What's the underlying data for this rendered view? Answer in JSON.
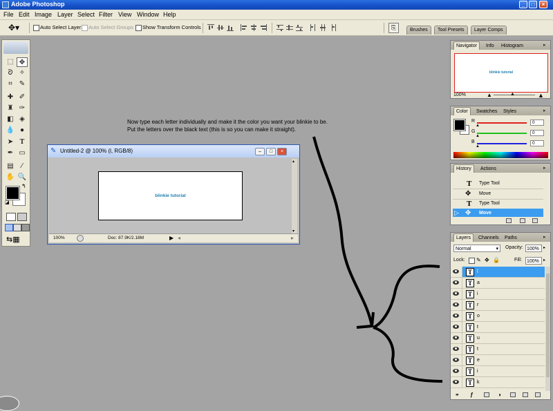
{
  "app": {
    "title": "Adobe Photoshop"
  },
  "menu": [
    "File",
    "Edit",
    "Image",
    "Layer",
    "Select",
    "Filter",
    "View",
    "Window",
    "Help"
  ],
  "options": {
    "auto_select_layer": "Auto Select Layer",
    "auto_select_groups": "Auto Select Groups",
    "show_transform_controls": "Show Transform Controls",
    "well_tabs": [
      "Brushes",
      "Tool Presets",
      "Layer Comps"
    ]
  },
  "instructions": [
    "Now type each letter individually and make it the color you want your blinkie to be.",
    "Put the letters over the black text (this is so you can make it straight)."
  ],
  "document": {
    "title": "Untitled-2 @ 100% (l, RGB/8)",
    "canvas_text": "blinkie tutorial",
    "zoom": "100%",
    "doc_info": "Doc: 87.9K/2.18M"
  },
  "navigator": {
    "tabs": [
      "Navigator",
      "Info",
      "Histogram"
    ],
    "preview_text": "blinkie tutorial",
    "zoom": "100%"
  },
  "color": {
    "tabs": [
      "Color",
      "Swatches",
      "Styles"
    ],
    "channels": [
      {
        "label": "R",
        "value": "0",
        "color": "#e02020"
      },
      {
        "label": "G",
        "value": "0",
        "color": "#20c020"
      },
      {
        "label": "B",
        "value": "0",
        "color": "#2020e0"
      }
    ]
  },
  "history": {
    "tabs": [
      "History",
      "Actions"
    ],
    "items": [
      "Type Tool",
      "Move",
      "Type Tool",
      "Move"
    ]
  },
  "layers": {
    "tabs": [
      "Layers",
      "Channels",
      "Paths"
    ],
    "blend_mode": "Normal",
    "opacity_label": "Opacity:",
    "opacity": "100%",
    "lock_label": "Lock:",
    "fill_label": "Fill:",
    "fill": "100%",
    "items": [
      "l",
      "a",
      "i",
      "r",
      "o",
      "t",
      "u",
      "t",
      "e",
      "i",
      "k"
    ]
  },
  "colors": {
    "accent": "#3c9cf0",
    "canvas_text": "#1e7fb0",
    "workspace": "#a4a4a4"
  }
}
